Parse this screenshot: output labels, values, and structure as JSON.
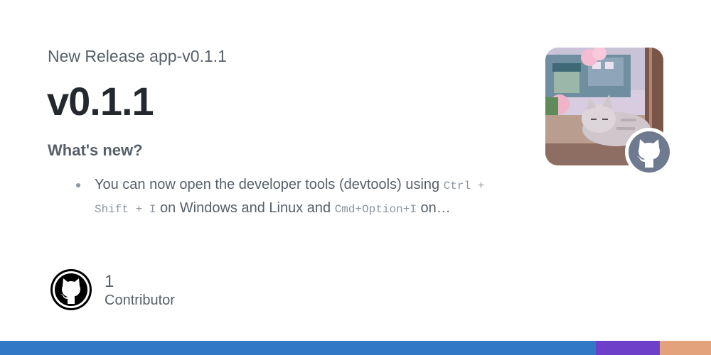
{
  "header": {
    "subtitle": "New Release app-v0.1.1",
    "title": "v0.1.1"
  },
  "release_notes": {
    "heading": "What's new?",
    "item": {
      "text_1": "You can now open the developer tools (devtools) using ",
      "code_1": "Ctrl + Shift + I",
      "text_2": " on Windows and Linux and ",
      "code_2": "Cmd+Option+I",
      "text_3": " on…"
    }
  },
  "contributors": {
    "count": "1",
    "label": "Contributor"
  },
  "icons": {
    "repo_art": "pixel-art-sleeping-cat-image",
    "badge": "github-octocat-icon",
    "avatar": "github-octocat-icon"
  },
  "colors": {
    "text_primary": "#24292f",
    "text_secondary": "#57606a",
    "language_segments": [
      {
        "color": "#3178c6",
        "share": 0.838
      },
      {
        "color": "#6e40c9",
        "share": 0.09
      },
      {
        "color": "#e4a27c",
        "share": 0.072
      }
    ]
  }
}
